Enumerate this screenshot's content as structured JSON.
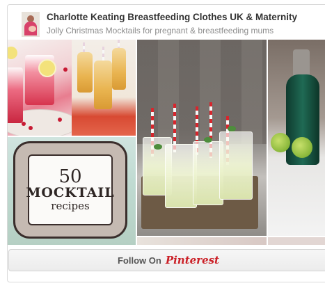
{
  "widget": {
    "board_title": "Charlotte Keating Breastfeeding Clothes UK & Maternity",
    "board_subtitle": "Jolly Christmas Mocktails for pregnant & breastfeeding mums",
    "pins": [
      {
        "id": "cranberry-mocktail",
        "accent": "#d7344e"
      },
      {
        "id": "bottled-juice",
        "accent": "#e9b450"
      },
      {
        "id": "mocktail-recipes",
        "lines": [
          "50",
          "MOCKTAIL",
          "recipes"
        ]
      },
      {
        "id": "lemonade-glasses",
        "accent": "#d7262d"
      },
      {
        "id": "soda-siphon",
        "accent": "#1f6a54"
      }
    ],
    "follow_button": {
      "label": "Follow On",
      "brand": "Pinterest",
      "brand_color": "#cb2027"
    }
  }
}
